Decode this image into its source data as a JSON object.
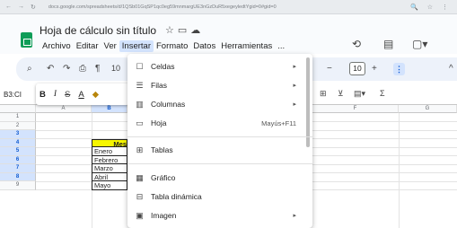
{
  "browser": {
    "url": "docs.google.com/spreadsheets/d/1QSb01GqSP1qc0eg59mnmargUE3nGzDuR5xegeyledtYgid=0#gid=0",
    "nav_icons": [
      "back-arrow-icon",
      "forward-arrow-icon",
      "reload-icon"
    ]
  },
  "header": {
    "title": "Hoja de cálculo sin título",
    "menu": [
      "Archivo",
      "Editar",
      "Ver",
      "Insertar",
      "Formato",
      "Datos",
      "Herramientas",
      "..."
    ],
    "active_menu": "Insertar"
  },
  "toolbar": {
    "zoom": "10",
    "font_size": "10"
  },
  "formula_bar": {
    "name_box": "B3:CI",
    "format_buttons": [
      "B",
      "I",
      "S",
      "A"
    ]
  },
  "grid": {
    "columns": [
      "A",
      "B",
      "F",
      "G"
    ],
    "rows": [
      "1",
      "2",
      "3",
      "4",
      "5",
      "6",
      "7",
      "8",
      "9"
    ],
    "cells": [
      "Mes",
      "Enero",
      "Febrero",
      "Marzo",
      "Abril",
      "Mayo"
    ]
  },
  "insert_menu": {
    "items": [
      {
        "label": "Celdas",
        "icon": "cell-icon",
        "submenu": true
      },
      {
        "label": "Filas",
        "icon": "rows-icon",
        "submenu": true
      },
      {
        "label": "Columnas",
        "icon": "columns-icon",
        "submenu": true
      },
      {
        "label": "Hoja",
        "icon": "sheet-icon",
        "shortcut": "Mayús+F11"
      },
      {
        "label": "Tablas",
        "icon": "table-icon"
      },
      {
        "label": "Gráfico",
        "icon": "chart-icon"
      },
      {
        "label": "Tabla dinámica",
        "icon": "pivot-table-icon"
      },
      {
        "label": "Imagen",
        "icon": "image-icon",
        "submenu": true
      }
    ]
  },
  "colors": {
    "accent": "#0b57d0",
    "highlight": "#f6f600",
    "logo": "#0f9d58"
  }
}
